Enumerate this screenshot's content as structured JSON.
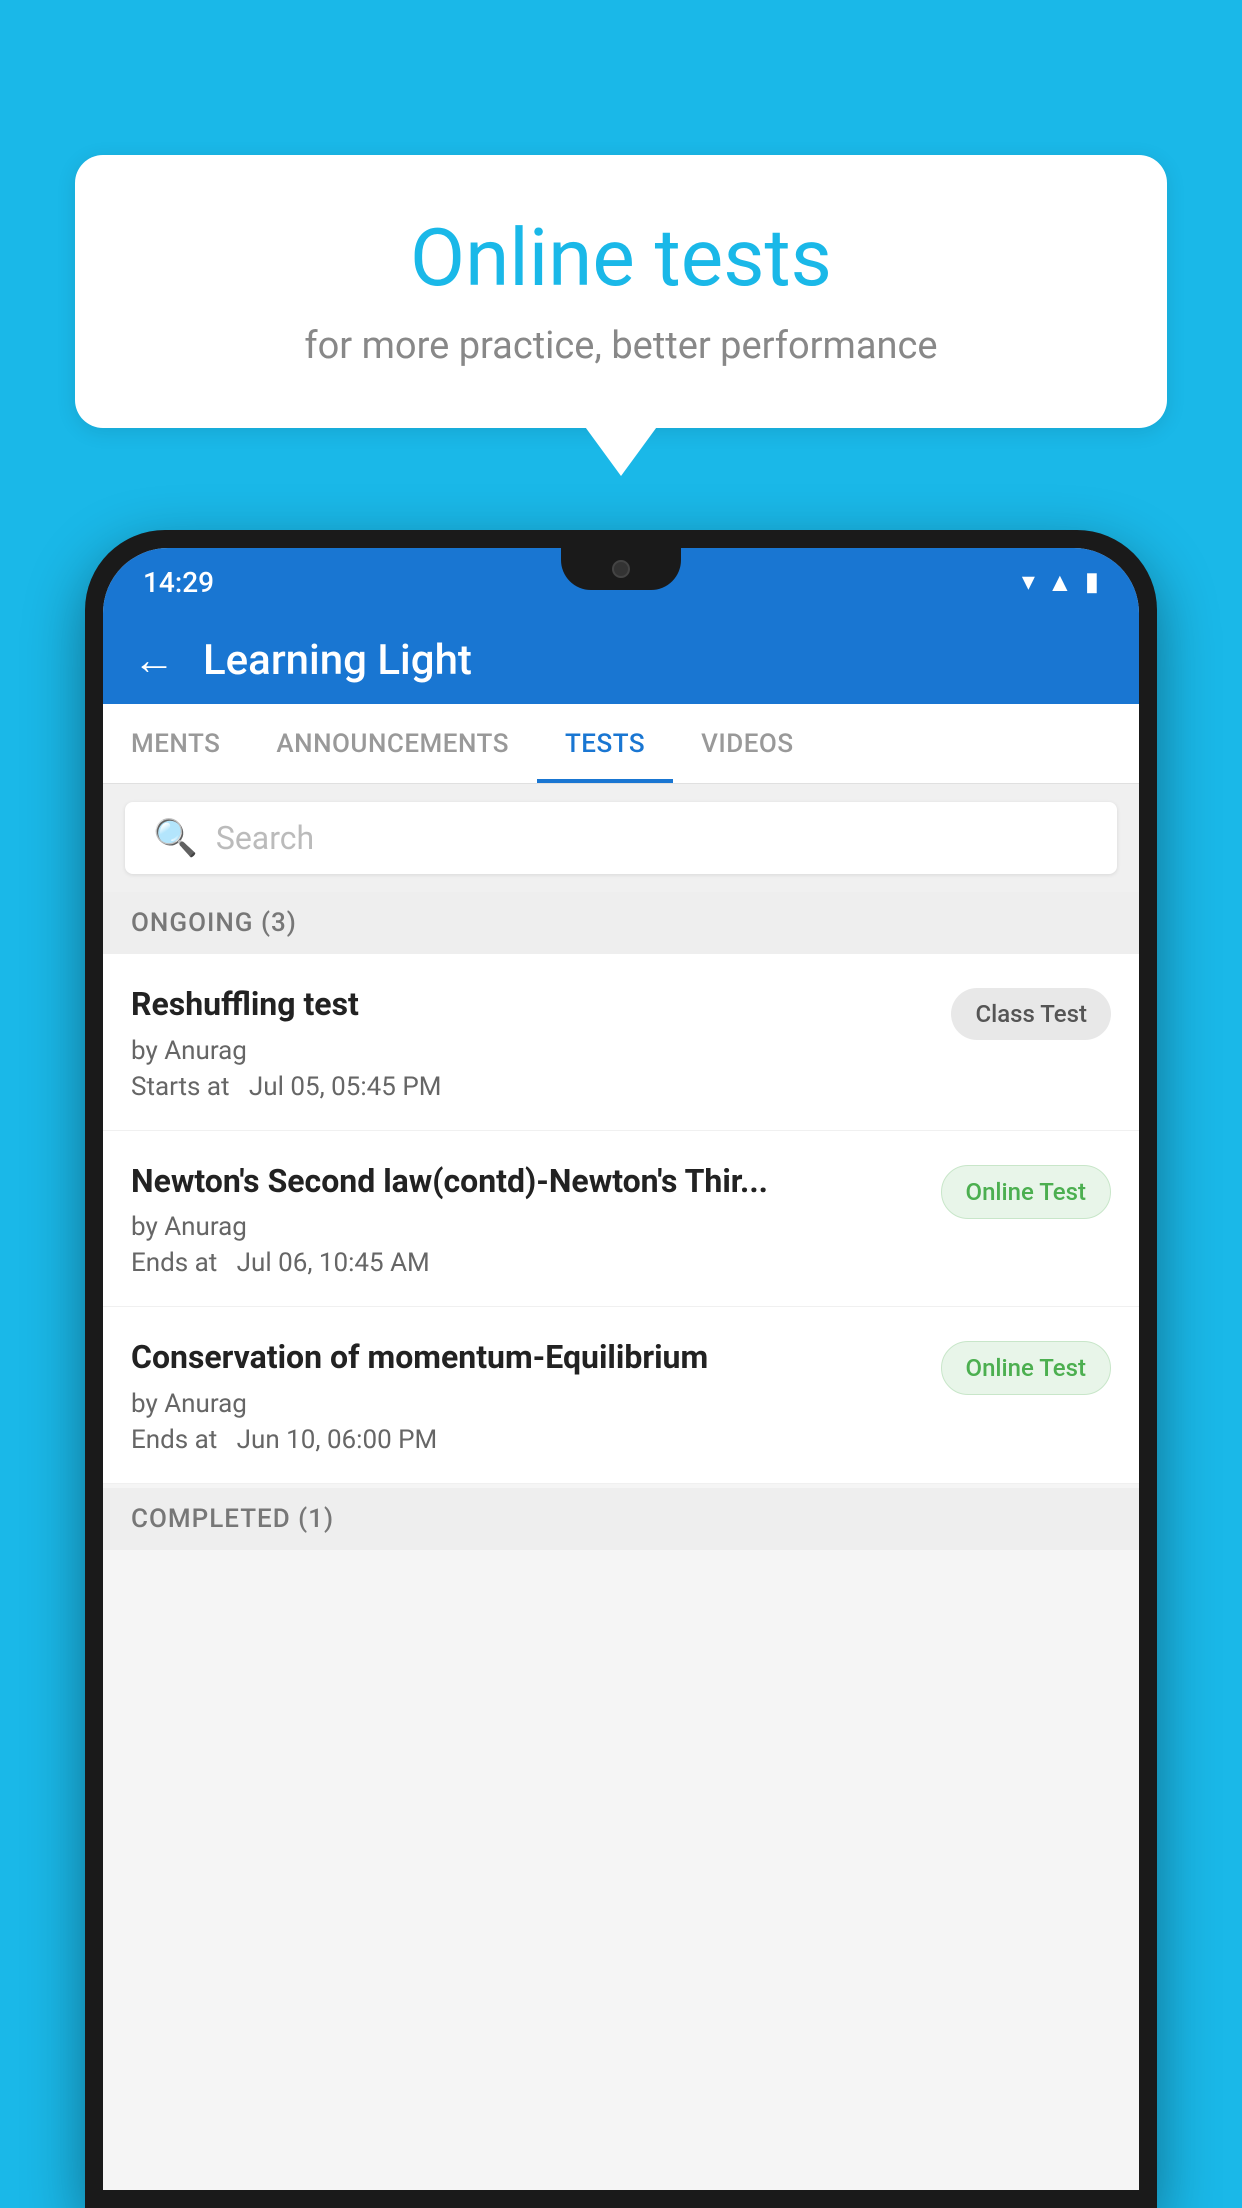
{
  "background_color": "#1ab8e8",
  "speech_bubble": {
    "title": "Online tests",
    "subtitle": "for more practice, better performance"
  },
  "phone": {
    "status_bar": {
      "time": "14:29",
      "wifi": "▾",
      "signal": "▲",
      "battery": "▮"
    },
    "app_header": {
      "back_label": "←",
      "title": "Learning Light"
    },
    "tabs": [
      {
        "label": "MENTS",
        "active": false
      },
      {
        "label": "ANNOUNCEMENTS",
        "active": false
      },
      {
        "label": "TESTS",
        "active": true
      },
      {
        "label": "VIDEOS",
        "active": false
      }
    ],
    "search": {
      "placeholder": "Search"
    },
    "sections": [
      {
        "label": "ONGOING (3)",
        "tests": [
          {
            "name": "Reshuffling test",
            "author": "by Anurag",
            "time_label": "Starts at",
            "time": "Jul 05, 05:45 PM",
            "badge": "Class Test",
            "badge_type": "class"
          },
          {
            "name": "Newton's Second law(contd)-Newton's Thir...",
            "author": "by Anurag",
            "time_label": "Ends at",
            "time": "Jul 06, 10:45 AM",
            "badge": "Online Test",
            "badge_type": "online"
          },
          {
            "name": "Conservation of momentum-Equilibrium",
            "author": "by Anurag",
            "time_label": "Ends at",
            "time": "Jun 10, 06:00 PM",
            "badge": "Online Test",
            "badge_type": "online"
          }
        ]
      }
    ],
    "completed_section_label": "COMPLETED (1)"
  }
}
